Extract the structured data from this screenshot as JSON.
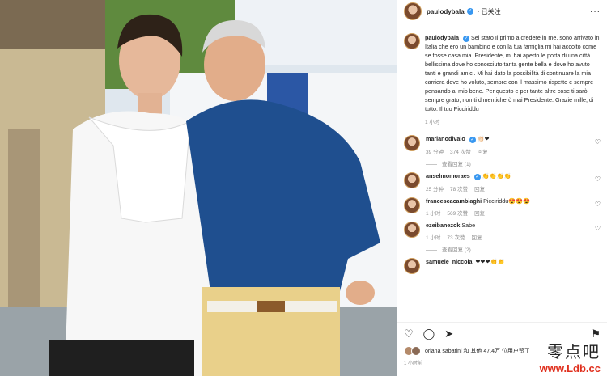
{
  "post": {
    "author": "paulodybala",
    "follow_label": "· 已关注",
    "menu_label": "···",
    "caption": "Sei stato Il primo a credere in me, sono arrivato in Italia che ero un bambino e con la tua famiglia mi hai accolto come se fosse casa mia. Presidente, mi hai aperto le porta di una città bellissima dove ho conosciuto tanta gente bella e dove ho avuto tanti e grandi amici. Mi hai dato la possibilità di continuare la mia carriera dove ho voluto, sempre con il massimo rispetto e sempre pensando al mio bene. Per questo e per tante altre cose ti sarò sempre grato, non ti dimenticherò mai Presidente. Grazie mille, di tutto. Il tuo Picciriddu",
    "caption_time": "1 小时",
    "likes_text": "oriana sabatini 和 其他 47.4万 位用户赞了",
    "post_time": "1 小时前"
  },
  "comments": [
    {
      "user": "marianodivaio",
      "verified": true,
      "text": "👏🏻❤",
      "time": "39 分钟",
      "likes": "374 次赞",
      "reply": "回复",
      "view_replies": "查看回复 (1)"
    },
    {
      "user": "anselmomoraes",
      "verified": true,
      "text": "👏👏👏👏",
      "time": "25 分钟",
      "likes": "78 次赞",
      "reply": "回复",
      "view_replies": ""
    },
    {
      "user": "francescacambiaghi",
      "verified": false,
      "text": "Picciriddu😍😍😍",
      "time": "1 小时",
      "likes": "569 次赞",
      "reply": "回复",
      "view_replies": ""
    },
    {
      "user": "ezeibanezok",
      "verified": false,
      "text": "Sabe",
      "time": "1 小时",
      "likes": "73 次赞",
      "reply": "回复",
      "view_replies": "查看回复 (2)"
    },
    {
      "user": "samuele_niccolai",
      "verified": false,
      "text": "❤❤❤👏👏",
      "time": "",
      "likes": "",
      "reply": "",
      "view_replies": ""
    }
  ],
  "icons": {
    "heart": "heart-icon",
    "comment": "comment-icon",
    "share": "share-icon",
    "bookmark": "bookmark-icon"
  },
  "watermark": {
    "cn": "零点吧",
    "url": "www.Ldb.cc"
  }
}
